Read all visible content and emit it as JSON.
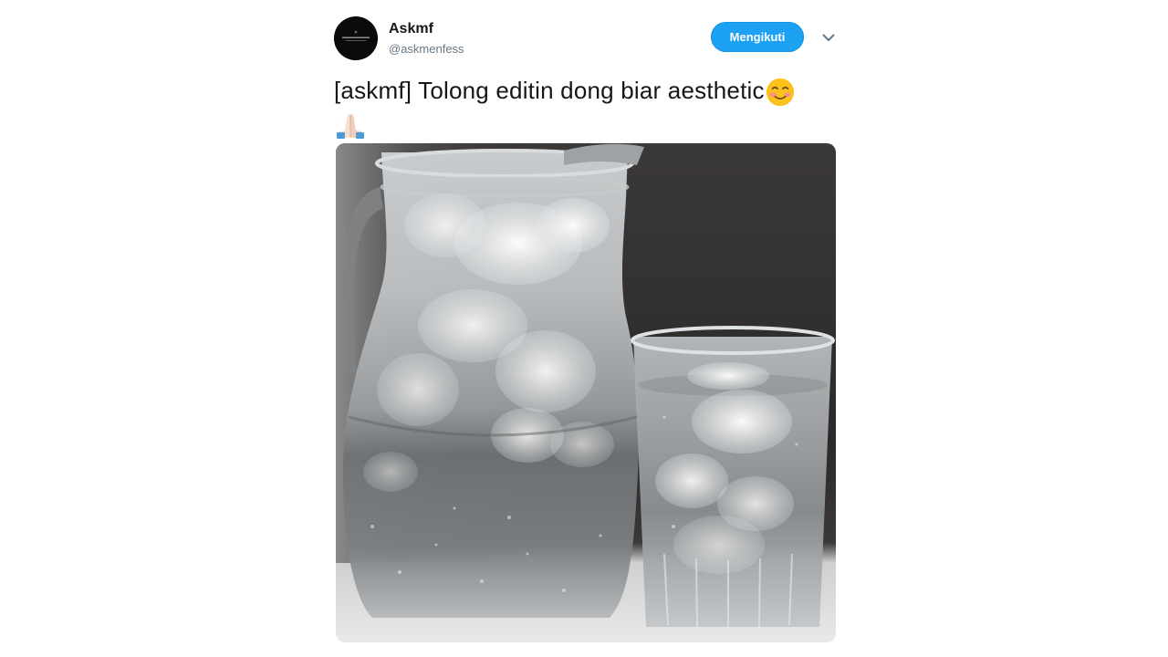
{
  "tweet": {
    "user": {
      "name": "Askmf",
      "handle": "@askmenfess",
      "avatar_icon": "askmf-logo-avatar"
    },
    "follow_button_label": "Mengikuti",
    "menu_icon": "chevron-down-icon",
    "text": "[askmf] Tolong editin dong biar aesthetic",
    "emojis": [
      "smiling-face-icon",
      "folded-hands-icon"
    ],
    "media": {
      "icon": "photo-water-jug-and-glass"
    }
  },
  "colors": {
    "accent": "#1da1f2",
    "name": "#14171a",
    "handle": "#657786"
  }
}
